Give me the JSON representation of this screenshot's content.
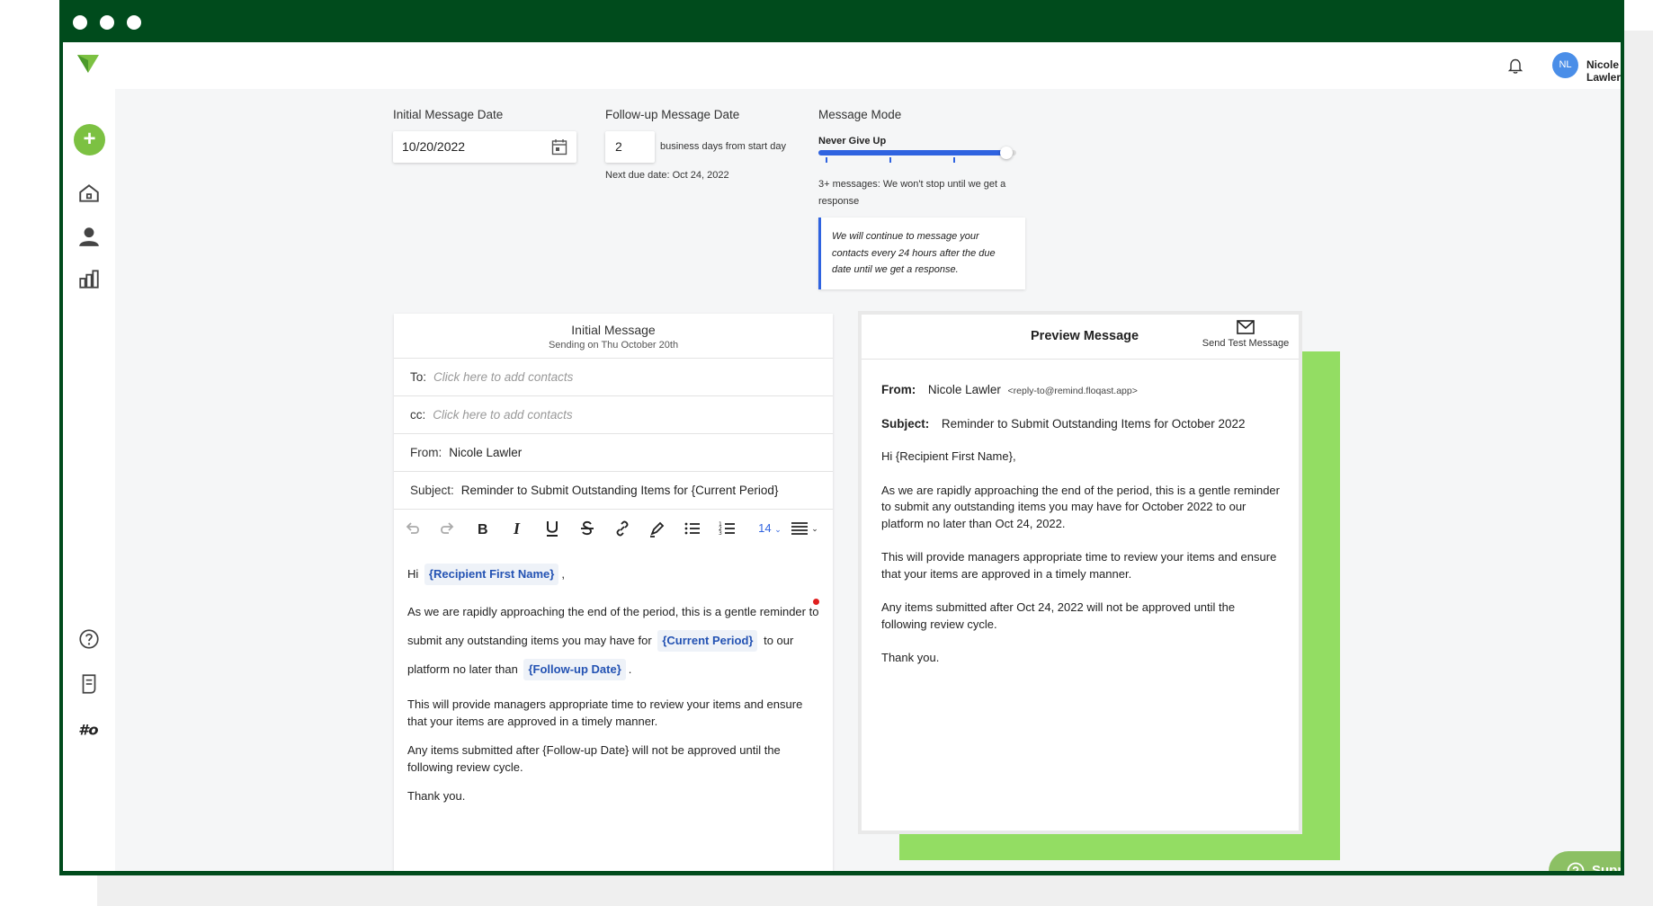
{
  "user": {
    "initials": "NL",
    "name": "Nicole Lawler"
  },
  "form": {
    "initial_date_label": "Initial Message Date",
    "initial_date_value": "10/20/2022",
    "followup_label": "Follow-up Message Date",
    "followup_days": "2",
    "followup_suffix": "business days from start day",
    "next_due": "Next due date: Oct 24, 2022",
    "mode_label": "Message Mode",
    "mode_name": "Never Give Up",
    "mode_level_percent": 95,
    "mode_desc": "3+ messages: We won't stop until we get a response",
    "mode_note": "We will continue to message your contacts every 24 hours after the due date until we get a response."
  },
  "editor": {
    "title": "Initial Message",
    "subtitle": "Sending on Thu October 20th",
    "to_label": "To:",
    "to_placeholder": "Click here to add contacts",
    "cc_label": "cc:",
    "cc_placeholder": "Click here to add contacts",
    "from_label": "From:",
    "from_value": "Nicole Lawler",
    "subject_label": "Subject:",
    "subject_value": "Reminder to Submit Outstanding Items for {Current Period}",
    "font_size": "14",
    "body": {
      "greeting": "Hi",
      "chip_name": "{Recipient First Name}",
      "greeting_end": ",",
      "p1_a": "As we are rapidly approaching the end of the period, this is a gentle reminder to submit any outstanding items you may have for",
      "chip_period": "{Current Period}",
      "p1_b": "to our platform no later than",
      "chip_followup": "{Follow-up Date}",
      "p1_end": ".",
      "p2": "This will provide managers appropriate time to review your items and ensure that your items are approved in a timely manner.",
      "p3": "Any items submitted after {Follow-up Date} will not be approved until the following review cycle.",
      "p4": "Thank you."
    }
  },
  "preview": {
    "title": "Preview Message",
    "send_test": "Send Test Message",
    "from_label": "From:",
    "from_name": "Nicole Lawler",
    "from_email": "<reply-to@remind.floqast.app>",
    "subject_label": "Subject:",
    "subject_value": "Reminder to Submit Outstanding Items for October 2022",
    "greeting": "Hi {Recipient First Name},",
    "p1": "As we are rapidly approaching the end of the period, this is a gentle reminder to submit any outstanding items you may have for October 2022 to our platform no later than Oct 24, 2022.",
    "p2": "This will provide managers appropriate time to review your items and ensure that your items are approved in a timely manner.",
    "p3": "Any items submitted after Oct 24, 2022 will not be approved until the following review cycle.",
    "p4": "Thank you."
  },
  "support": {
    "label": "Support"
  },
  "colors": {
    "brand_green": "#7cc142",
    "frame_green": "#004b1c",
    "accent_blue": "#2f63e0"
  }
}
